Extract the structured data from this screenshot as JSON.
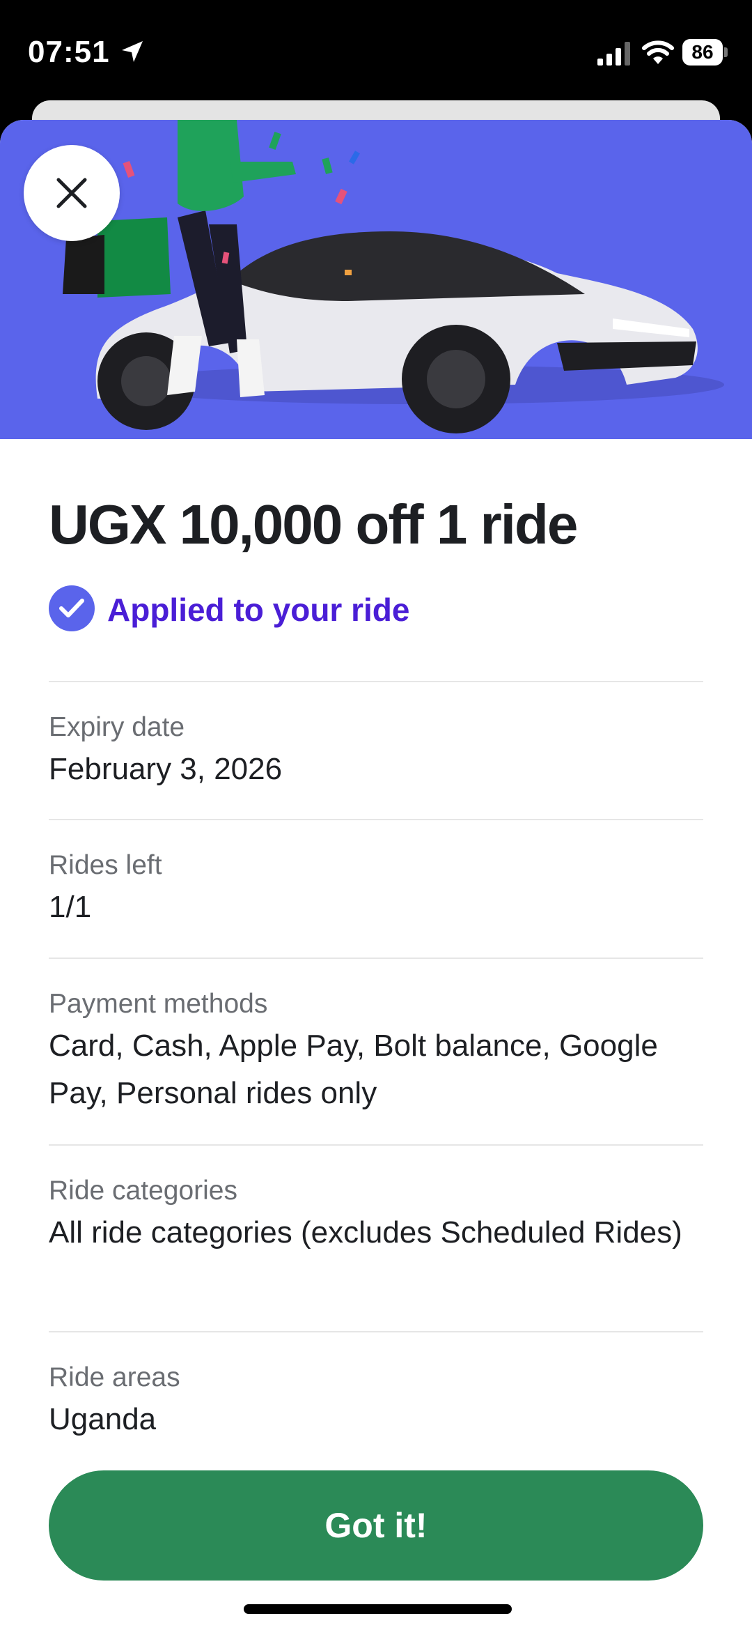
{
  "status_bar": {
    "time": "07:51",
    "battery": "86"
  },
  "promo": {
    "title": "UGX 10,000 off 1 ride",
    "applied_text": "Applied to your ride",
    "details": [
      {
        "label": "Expiry date",
        "value": "February 3, 2026"
      },
      {
        "label": "Rides left",
        "value": "1/1"
      },
      {
        "label": "Payment methods",
        "value": "Card, Cash, Apple Pay, Bolt balance, Google Pay, Personal rides only"
      },
      {
        "label": "Ride categories",
        "value": "All ride categories (excludes Scheduled Rides)"
      },
      {
        "label": "Ride areas",
        "value": "Uganda"
      }
    ],
    "button_label": "Got it!"
  },
  "colors": {
    "hero": "#5a64eb",
    "accent_text": "#4a1ed6",
    "button": "#2b8a57"
  },
  "icons": {
    "close": "close-icon",
    "check": "check-icon"
  }
}
